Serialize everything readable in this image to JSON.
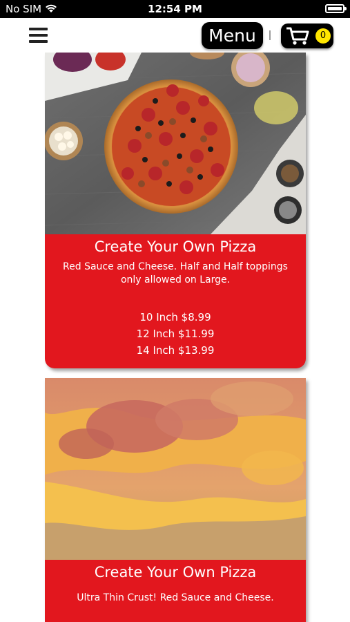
{
  "status_bar": {
    "carrier": "No SIM",
    "time": "12:54 PM"
  },
  "header": {
    "menu_label": "Menu",
    "cart_count": "0"
  },
  "cards": [
    {
      "title": "Create Your Own Pizza",
      "description": "Red Sauce and Cheese. Half and Half toppings only allowed on Large.",
      "prices": [
        "10 Inch $8.99",
        "12 Inch $11.99",
        "14 Inch $13.99"
      ]
    },
    {
      "title": "Create Your Own Pizza",
      "description": "Ultra Thin Crust! Red Sauce and Cheese."
    }
  ],
  "colors": {
    "card_background": "#e2171e",
    "header_button": "#000000",
    "cart_badge": "#ffe600"
  }
}
